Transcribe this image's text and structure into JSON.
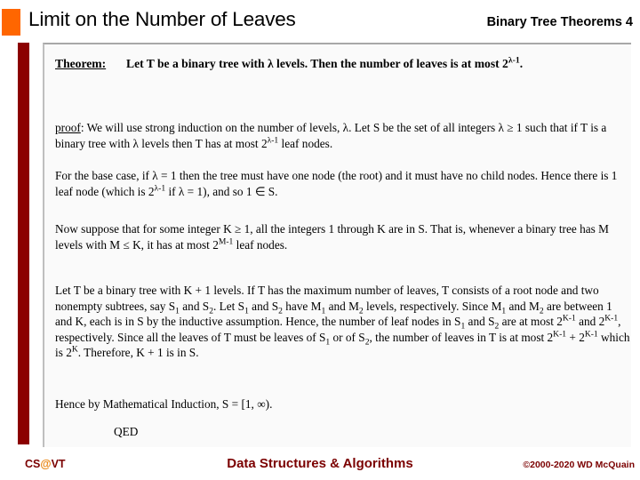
{
  "header": {
    "title": "Limit on the Number of Leaves",
    "subtitle": "Binary Tree Theorems  4",
    "accent_color": "#FF6600"
  },
  "content": {
    "theorem_label": "Theorem:",
    "theorem_statement_pre": "Let T be a binary tree with λ levels. Then the number of leaves is at most 2",
    "theorem_exponent": "λ-1",
    "theorem_statement_post": ".",
    "proof_label": "proof",
    "paragraphs": {
      "proof_intro_a": ":  We will use strong induction on the number of levels, λ.  Let S be the set of all integers λ ≥ 1 such that if T is a binary tree with λ levels then T has at most 2",
      "proof_intro_exp": "λ-1",
      "proof_intro_b": " leaf nodes.",
      "base_case_a": "For the base case, if λ = 1 then the tree must have one node (the root) and it must have no child nodes. Hence there is 1 leaf node (which is 2",
      "base_case_exp": "λ-1",
      "base_case_b": " if λ = 1), and so 1 ∈ S.",
      "inductive_hyp_a": "Now suppose that for some integer K ≥ 1, all the integers 1 through K are in S.  That is, whenever a binary tree has M levels with M ≤ K, it has at most 2",
      "inductive_hyp_exp": "M-1",
      "inductive_hyp_b": " leaf nodes.",
      "step_1": "Let T be a binary tree with K + 1 levels. If T has the maximum number of leaves, T consists of a root node and two nonempty subtrees, say S",
      "step_sub_1": "1",
      "step_2": " and S",
      "step_sub_2": "2",
      "step_3": ".  Let S",
      "step_sub_3": "1",
      "step_4": " and S",
      "step_sub_4": "2",
      "step_5": " have M",
      "step_sub_5": "1",
      "step_6": " and M",
      "step_sub_6": "2",
      "step_7": " levels, respectively. Since M",
      "step_sub_7": "1",
      "step_8": " and M",
      "step_sub_8": "2",
      "step_9": " are between 1 and K, each is in S by the inductive assumption.  Hence, the number of leaf nodes in S",
      "step_sub_9": "1",
      "step_10": " and S",
      "step_sub_10": "2",
      "step_11": " are at most 2",
      "step_exp_1": "K-1",
      "step_12": " and 2",
      "step_exp_2": "K-1",
      "step_13": ", respectively.  Since all the leaves of T must be leaves of S",
      "step_sub_11": "1",
      "step_14": " or of S",
      "step_sub_12": "2",
      "step_15": ", the number of leaves in T is at most 2",
      "step_exp_3": "K-1",
      "step_16": " + 2",
      "step_exp_4": "K-1",
      "step_17": " which is 2",
      "step_exp_5": "K",
      "step_18": ".  Therefore, K + 1 is in S.",
      "conclusion": "Hence by Mathematical Induction, S = [1, ∞).",
      "qed": "QED"
    }
  },
  "footer": {
    "left_prefix": "CS",
    "left_at": "@",
    "left_suffix": "VT",
    "center": "Data Structures & Algorithms",
    "right": "©2000-2020 WD McQuain",
    "brand_color": "#7B0000"
  }
}
